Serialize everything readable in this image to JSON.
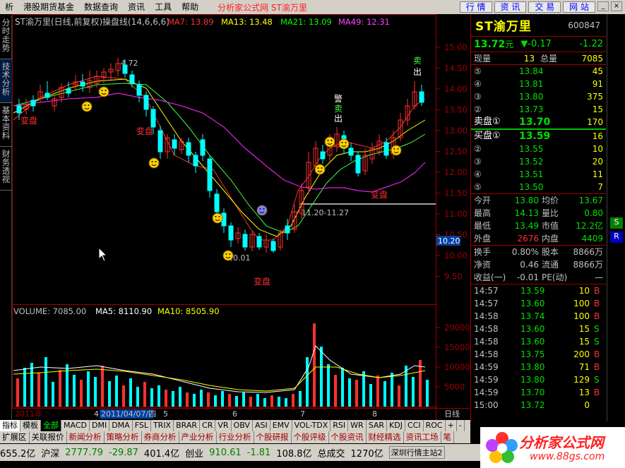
{
  "menu": {
    "items": [
      "析",
      "港股期货基金",
      "数据查询",
      "资讯",
      "工具",
      "帮助"
    ],
    "title": "分析家公式网 ST渝万里",
    "buttons": [
      "行 情",
      "资 讯",
      "交 易",
      "网 站"
    ]
  },
  "left_tabs": [
    "分时走势",
    "技术分析",
    "基本资料",
    "财务透视"
  ],
  "chart": {
    "header_name": "ST渝万里(日线,前复权)",
    "header_indicator": "操盘线(14,6,6,6)",
    "ma": [
      {
        "label": "MA7: 13.89",
        "color": "#ff3030"
      },
      {
        "label": "MA13: 13.48",
        "color": "#ffff00"
      },
      {
        "label": "MA21: 13.09",
        "color": "#00ff00"
      },
      {
        "label": "MA49: 12.31",
        "color": "#ff40ff"
      }
    ],
    "price_ticks": [
      "15.00",
      "14.50",
      "14.00",
      "13.50",
      "13.00",
      "12.50",
      "12.00",
      "11.50",
      "11.00",
      "10.50",
      "10.00",
      "9.50"
    ],
    "current_price_label": "10.20",
    "annotations": {
      "high": "4.72",
      "low": "10.01",
      "range": "11.20-11.27",
      "biangpan": "变盘"
    },
    "signals": {
      "jing": "警",
      "mai": "卖",
      "chu": "出"
    },
    "volume_header": "VOLUME: 7085.00",
    "ma5": "MA5: 8110.90",
    "ma10": "MA10: 8505.90",
    "volume_ticks": [
      "20000",
      "15000",
      "10000",
      "5000"
    ],
    "x_labels": [
      "2011年",
      "4",
      "2011/04/07/四",
      "5",
      "6",
      "7",
      "8"
    ],
    "period": "日线"
  },
  "quote": {
    "name": "ST渝万里",
    "code": "600847",
    "price": "13.72",
    "unit": "元",
    "change": "▼-0.17",
    "change_pct": "-1.22",
    "now_vol_label": "现量",
    "now_vol": "13",
    "total_vol_label": "总量",
    "total_vol": "7085",
    "sell": [
      {
        "lv": "⑤",
        "p": "13.84",
        "v": "45"
      },
      {
        "lv": "④",
        "p": "13.81",
        "v": "91"
      },
      {
        "lv": "③",
        "p": "13.80",
        "v": "375"
      },
      {
        "lv": "②",
        "p": "13.73",
        "v": "15"
      },
      {
        "lv": "卖盘①",
        "p": "13.70",
        "v": "170"
      }
    ],
    "buy": [
      {
        "lv": "买盘①",
        "p": "13.59",
        "v": "16"
      },
      {
        "lv": "②",
        "p": "13.55",
        "v": "10"
      },
      {
        "lv": "③",
        "p": "13.52",
        "v": "20"
      },
      {
        "lv": "④",
        "p": "13.51",
        "v": "11"
      },
      {
        "lv": "⑤",
        "p": "13.50",
        "v": "7"
      }
    ],
    "stats": [
      {
        "a": "今开",
        "av": "13.80",
        "b": "均价",
        "bv": "13.67"
      },
      {
        "a": "最高",
        "av": "14.13",
        "b": "量比",
        "bv": "0.80"
      },
      {
        "a": "最低",
        "av": "13.49",
        "b": "市值",
        "bv": "12.2亿"
      },
      {
        "a": "外盘",
        "av": "2676",
        "b": "内盘",
        "bv": "4409"
      }
    ],
    "stats2": [
      {
        "a": "换手",
        "av": "0.80%",
        "b": "股本",
        "bv": "8866万"
      },
      {
        "a": "净资",
        "av": "0.46",
        "b": "流通",
        "bv": "8866万"
      },
      {
        "a": "收益(一)",
        "av": "-0.01",
        "b": "PE(动)",
        "bv": "—"
      }
    ],
    "ticks": [
      {
        "t": "14:57",
        "p": "13.59",
        "v": "10",
        "d": "B"
      },
      {
        "t": "14:57",
        "p": "13.60",
        "v": "100",
        "d": "B"
      },
      {
        "t": "14:58",
        "p": "13.74",
        "v": "100",
        "d": "B"
      },
      {
        "t": "14:58",
        "p": "13.60",
        "v": "15",
        "d": "S"
      },
      {
        "t": "14:58",
        "p": "13.60",
        "v": "15",
        "d": "S"
      },
      {
        "t": "14:58",
        "p": "13.75",
        "v": "200",
        "d": "B"
      },
      {
        "t": "14:59",
        "p": "13.80",
        "v": "71",
        "d": "B"
      },
      {
        "t": "14:59",
        "p": "13.80",
        "v": "129",
        "d": "S"
      },
      {
        "t": "14:59",
        "p": "13.70",
        "v": "13",
        "d": "B"
      },
      {
        "t": "15:00",
        "p": "13.72",
        "v": "0",
        "d": ""
      }
    ]
  },
  "tabs": [
    "指标",
    "模板",
    "全部",
    "MACD",
    "DMI",
    "DMA",
    "FSL",
    "TRIX",
    "BRAR",
    "CR",
    "VR",
    "OBV",
    "ASI",
    "EMV",
    "VOL-TDX",
    "RSI",
    "WR",
    "SAR",
    "KDJ",
    "CCI",
    "ROC",
    "+",
    "-"
  ],
  "links": [
    "扩展区",
    "关联报价",
    "新闻分析",
    "策略分析",
    "券商分析",
    "产业分析",
    "行业分析",
    "个股研报",
    "个股评级",
    "个股资讯",
    "财经精选",
    "资讯工场",
    "笔"
  ],
  "ticker": {
    "a": "655.2亿",
    "sz_label": "沪深",
    "sz": "2777.79",
    "sz_chg": "-29.87",
    "sz_amt": "401.4亿",
    "cy_label": "创业",
    "cy": "910.61",
    "cy_chg": "-1.81",
    "cy_amt": "108.8亿",
    "total_label": "总成交",
    "total": "1270亿",
    "site": "深圳行情主站2"
  },
  "logo": {
    "text": "分析家公式网",
    "url": "www.88gs.com"
  },
  "side": [
    "S",
    "R"
  ]
}
